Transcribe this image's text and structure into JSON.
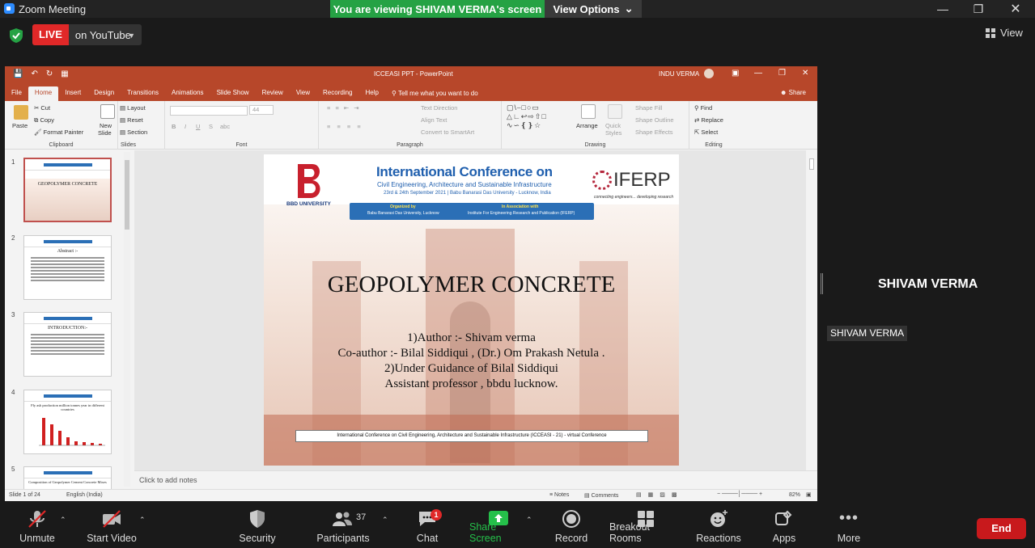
{
  "window": {
    "app_title": "Zoom Meeting",
    "viewing_banner": "You are viewing SHIVAM VERMA's screen",
    "view_options": "View Options"
  },
  "live": {
    "badge": "LIVE",
    "destination": "on YouTube"
  },
  "view_button": "View",
  "ppt": {
    "doc_title": "ICCEASI PPT  -  PowerPoint",
    "user": "INDU VERMA",
    "tabs": [
      "File",
      "Home",
      "Insert",
      "Design",
      "Transitions",
      "Animations",
      "Slide Show",
      "Review",
      "View",
      "Recording",
      "Help"
    ],
    "tell_me": "Tell me what you want to do",
    "share": "Share",
    "ribbon": {
      "clipboard": {
        "paste": "Paste",
        "cut": "Cut",
        "copy": "Copy",
        "format_painter": "Format Painter",
        "label": "Clipboard"
      },
      "slides": {
        "new_slide_1": "New",
        "new_slide_2": "Slide",
        "layout": "Layout",
        "reset": "Reset",
        "section": "Section",
        "label": "Slides"
      },
      "font": {
        "size": "44",
        "label": "Font"
      },
      "paragraph": {
        "text_direction": "Text Direction",
        "align_text": "Align Text",
        "smartart": "Convert to SmartArt",
        "label": "Paragraph"
      },
      "drawing": {
        "arrange": "Arrange",
        "quick_1": "Quick",
        "quick_2": "Styles",
        "shape_fill": "Shape Fill",
        "shape_outline": "Shape Outline",
        "shape_effects": "Shape Effects",
        "label": "Drawing"
      },
      "editing": {
        "find": "Find",
        "replace": "Replace",
        "select": "Select",
        "label": "Editing"
      }
    },
    "thumbnails": [
      {
        "num": "1",
        "title": "GEOPOLYMER CONCRETE"
      },
      {
        "num": "2",
        "title": "Abstract :-"
      },
      {
        "num": "3",
        "title": "INTRODUCTION:-"
      },
      {
        "num": "4",
        "title": "Fly ash production million tonnes year in different countries"
      },
      {
        "num": "5",
        "title": "Composition of Geopolymer Cement Concrete Mixes"
      }
    ],
    "slide": {
      "bbd": "BBD UNIVERSITY",
      "conf_title": "International Conference on",
      "conf_sub": "Civil Engineering, Architecture and Sustainable Infrastructure",
      "conf_date": "23rd & 24th September 2021 | Babu Banarasi Das University - Lucknow, India",
      "org_1": "Organized by",
      "org_2": "Babu Banarasi Das University, Lucknow",
      "assoc_1": "In Association with",
      "assoc_2": "Institute For Engineering Research and Publication (IFERP)",
      "iferp": "IFERP",
      "iferp_tag": "connecting engineers... developing research",
      "title": "GEOPOLYMER CONCRETE",
      "lines": [
        "1)Author :- Shivam verma",
        "Co-author :- Bilal Siddiqui , (Dr.) Om Prakash Netula .",
        "2)Under Guidance of  Bilal Siddiqui",
        "Assistant professor , bbdu lucknow."
      ],
      "footer": "International Conference on Civil Engineering, Architecture and Sustainable Infrastructure (ICCEASI - 21) - virtual Conference"
    },
    "notes_placeholder": "Click to add notes",
    "status": {
      "slide": "Slide 1 of 24",
      "language": "English (India)",
      "notes": "Notes",
      "comments": "Comments",
      "zoom": "82%"
    }
  },
  "participant": {
    "name_big": "SHIVAM VERMA",
    "name_tag": "SHIVAM VERMA"
  },
  "toolbar": {
    "unmute": "Unmute",
    "start_video": "Start Video",
    "security": "Security",
    "participants": "Participants",
    "participants_count": "37",
    "chat": "Chat",
    "chat_badge": "1",
    "share_screen": "Share Screen",
    "record": "Record",
    "breakout": "Breakout Rooms",
    "reactions": "Reactions",
    "apps": "Apps",
    "more": "More",
    "end": "End"
  },
  "colors": {
    "share_green": "#25a244",
    "ppt_red": "#b7472a",
    "end_red": "#c8191c",
    "live_red": "#e02828"
  }
}
